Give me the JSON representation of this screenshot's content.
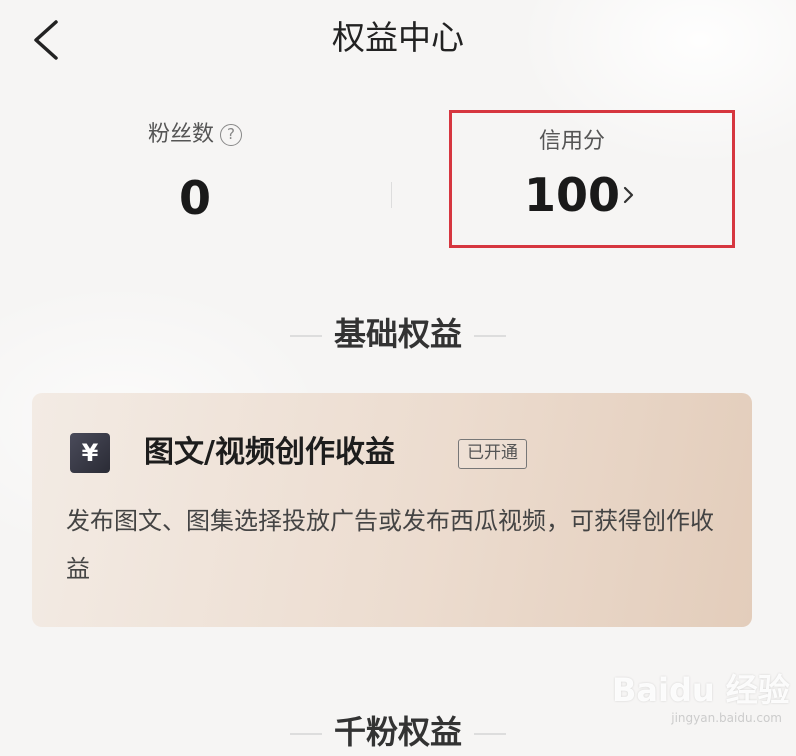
{
  "header": {
    "title": "权益中心"
  },
  "stats": {
    "fans": {
      "label": "粉丝数",
      "help": "?",
      "value": "0"
    },
    "credit": {
      "label": "信用分",
      "value": "100"
    }
  },
  "sections": {
    "basic": "基础权益",
    "thousand": "千粉权益"
  },
  "benefit_card": {
    "icon_symbol": "¥",
    "title": "图文/视频创作收益",
    "status": "已开通",
    "description": "发布图文、图集选择投放广告或发布西瓜视频，可获得创作收益"
  },
  "watermark": {
    "logo": "Baidu 经验",
    "url": "jingyan.baidu.com"
  },
  "colors": {
    "highlight_border": "#d6363f",
    "card_gradient_start": "#f3ebe4",
    "card_gradient_end": "#e3cdbb"
  }
}
